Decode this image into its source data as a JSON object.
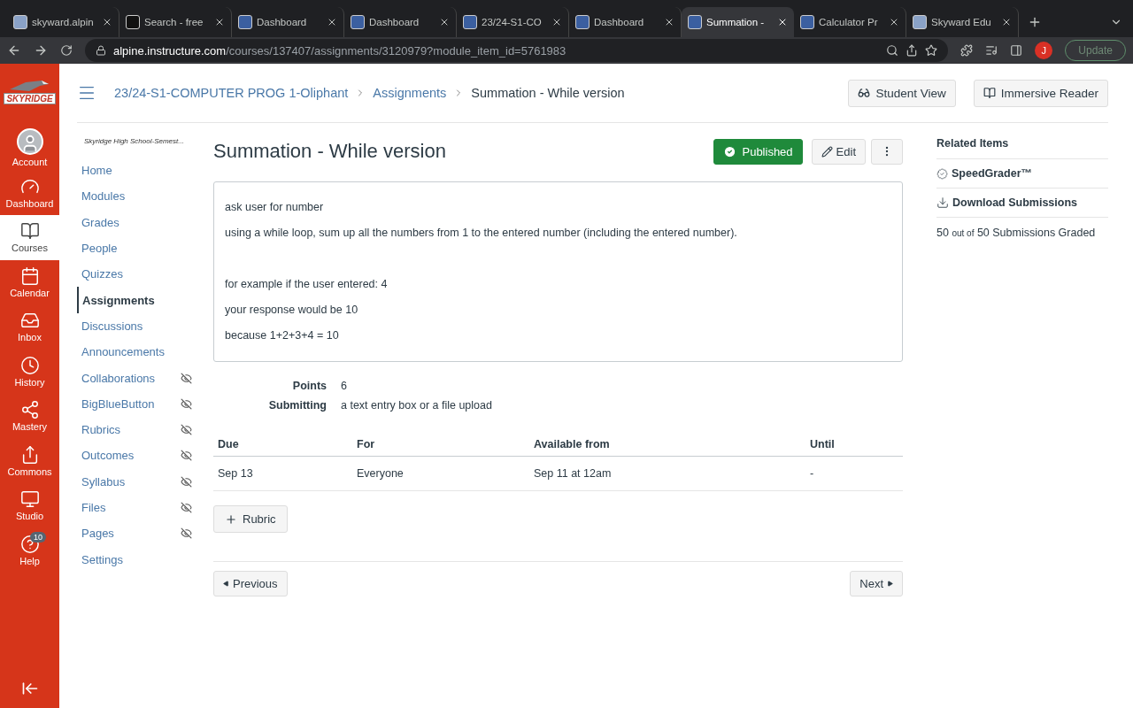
{
  "browser": {
    "tabs": [
      {
        "title": "skyward.alpin",
        "selected": false,
        "kind": "skyward"
      },
      {
        "title": "Search - free",
        "selected": false,
        "kind": "search"
      },
      {
        "title": "Dashboard",
        "selected": false,
        "kind": "district"
      },
      {
        "title": "Dashboard",
        "selected": false,
        "kind": "district"
      },
      {
        "title": "23/24-S1-CO",
        "selected": false,
        "kind": "district"
      },
      {
        "title": "Dashboard",
        "selected": false,
        "kind": "district"
      },
      {
        "title": "Summation -",
        "selected": true,
        "kind": "district"
      },
      {
        "title": "Calculator Pr",
        "selected": false,
        "kind": "district"
      },
      {
        "title": "Skyward Edu",
        "selected": false,
        "kind": "skyward"
      }
    ],
    "url_host": "alpine.instructure.com",
    "url_path": "/courses/137407/assignments/3120979?module_item_id=5761983",
    "profile": "J",
    "update_button": "Update"
  },
  "global_nav": {
    "logo": "SKYRIDGE",
    "items": [
      {
        "label": "Account",
        "selected": false
      },
      {
        "label": "Dashboard",
        "selected": false
      },
      {
        "label": "Courses",
        "selected": true
      },
      {
        "label": "Calendar",
        "selected": false
      },
      {
        "label": "Inbox",
        "selected": false
      },
      {
        "label": "History",
        "selected": false
      },
      {
        "label": "Mastery",
        "selected": false
      },
      {
        "label": "Commons",
        "selected": false
      },
      {
        "label": "Studio",
        "selected": false
      },
      {
        "label": "Help",
        "selected": false,
        "badge": "10"
      }
    ]
  },
  "breadcrumbs": [
    "23/24-S1-COMPUTER PROG 1-Oliphant",
    "Assignments",
    "Summation - While version"
  ],
  "header_buttons": [
    "Student View",
    "Immersive Reader"
  ],
  "course_nav": {
    "term": "Skyridge High School-Semest...",
    "items": [
      {
        "label": "Home",
        "selected": false,
        "hidden": false
      },
      {
        "label": "Modules",
        "selected": false,
        "hidden": false
      },
      {
        "label": "Grades",
        "selected": false,
        "hidden": false
      },
      {
        "label": "People",
        "selected": false,
        "hidden": false
      },
      {
        "label": "Quizzes",
        "selected": false,
        "hidden": false
      },
      {
        "label": "Assignments",
        "selected": true,
        "hidden": false
      },
      {
        "label": "Discussions",
        "selected": false,
        "hidden": false
      },
      {
        "label": "Announcements",
        "selected": false,
        "hidden": false
      },
      {
        "label": "Collaborations",
        "selected": false,
        "hidden": true
      },
      {
        "label": "BigBlueButton",
        "selected": false,
        "hidden": true
      },
      {
        "label": "Rubrics",
        "selected": false,
        "hidden": true
      },
      {
        "label": "Outcomes",
        "selected": false,
        "hidden": true
      },
      {
        "label": "Syllabus",
        "selected": false,
        "hidden": true
      },
      {
        "label": "Files",
        "selected": false,
        "hidden": true
      },
      {
        "label": "Pages",
        "selected": false,
        "hidden": true
      },
      {
        "label": "Settings",
        "selected": false,
        "hidden": false
      }
    ]
  },
  "assignment": {
    "title": "Summation - While version",
    "published": true,
    "published_label": "Published",
    "edit_label": "Edit",
    "description": [
      [
        "ask user for number",
        "using a while loop, sum up all the numbers from 1 to the entered number (including the entered number)."
      ],
      [
        "for example if the user entered: 4",
        "your response would be 10",
        "because 1+2+3+4 = 10"
      ]
    ],
    "details": [
      {
        "label": "Points",
        "value": "6"
      },
      {
        "label": "Submitting",
        "value": "a text entry box or a file upload"
      }
    ],
    "table": {
      "columns": [
        "Due",
        "For",
        "Available from",
        "Until"
      ],
      "rows": [
        [
          "Sep 13",
          "Everyone",
          "Sep 11 at 12am",
          "-"
        ]
      ]
    },
    "rubric_button": "Rubric",
    "previous": "Previous",
    "next": "Next"
  },
  "related": {
    "title": "Related Items",
    "links": [
      "SpeedGrader™",
      "Download Submissions"
    ],
    "graded": {
      "count": "50",
      "connector": "out of",
      "total": "50 Submissions Graded"
    }
  }
}
